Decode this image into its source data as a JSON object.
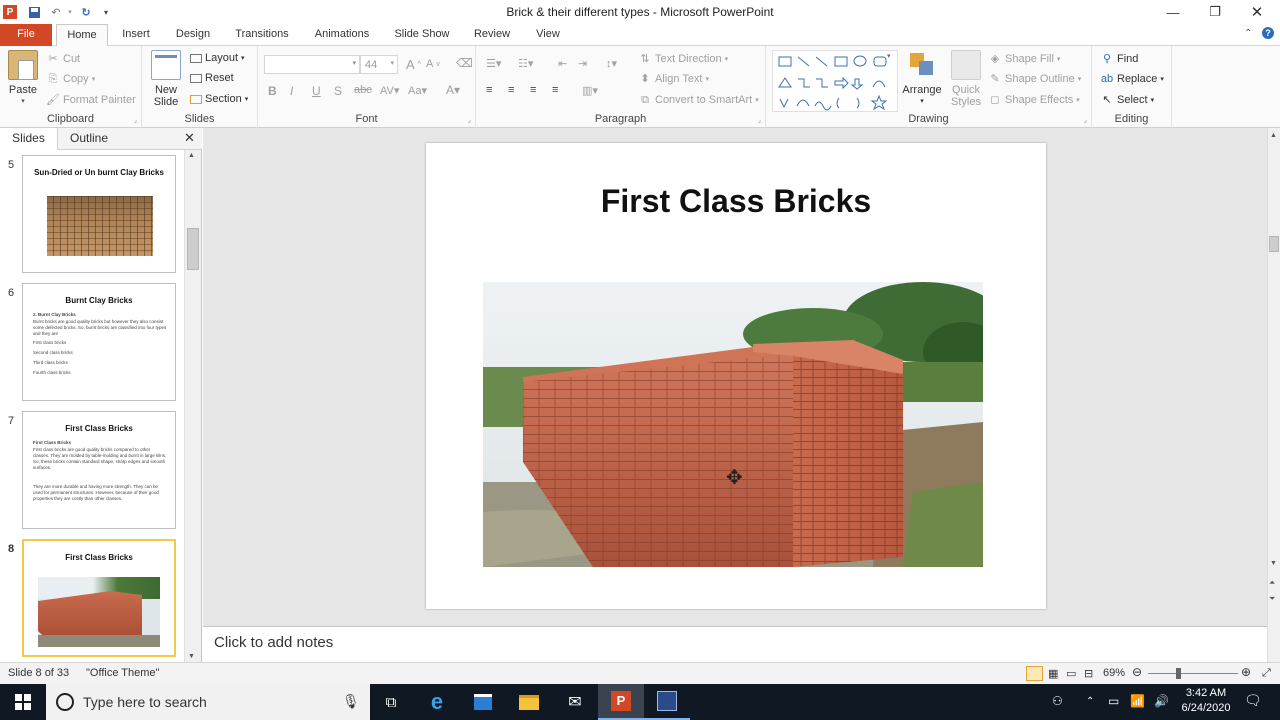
{
  "window": {
    "title": "Brick & their different types  -  Microsoft PowerPoint"
  },
  "tabs": [
    "File",
    "Home",
    "Insert",
    "Design",
    "Transitions",
    "Animations",
    "Slide Show",
    "Review",
    "View"
  ],
  "ribbon": {
    "clipboard": {
      "paste": "Paste",
      "cut": "Cut",
      "copy": "Copy",
      "format_painter": "Format Painter",
      "label": "Clipboard"
    },
    "slides": {
      "new_slide": "New Slide",
      "layout": "Layout",
      "reset": "Reset",
      "section": "Section",
      "label": "Slides"
    },
    "font": {
      "size": "44",
      "label": "Font"
    },
    "paragraph": {
      "text_direction": "Text Direction",
      "align_text": "Align Text",
      "convert": "Convert to SmartArt",
      "label": "Paragraph"
    },
    "drawing": {
      "arrange": "Arrange",
      "quick_styles": "Quick Styles",
      "shape_fill": "Shape Fill",
      "shape_outline": "Shape Outline",
      "shape_effects": "Shape Effects",
      "label": "Drawing"
    },
    "editing": {
      "find": "Find",
      "replace": "Replace",
      "select": "Select",
      "label": "Editing"
    }
  },
  "panel": {
    "tab_slides": "Slides",
    "tab_outline": "Outline"
  },
  "thumbnails": [
    {
      "num": "5",
      "title": "Sun-Dried or Un burnt Clay Bricks",
      "body": []
    },
    {
      "num": "6",
      "title": "Burnt Clay Bricks",
      "body": [
        "2. Burnt Clay Bricks",
        "Burnt bricks are good quality bricks but however they also consist some defected bricks. So, burnt bricks are classified into four types and they are",
        "First class bricks",
        "Second class bricks",
        "Third class bricks",
        "Fourth class bricks"
      ]
    },
    {
      "num": "7",
      "title": "First Class Bricks",
      "body": [
        "First Class Bricks",
        "First class bricks are good quality bricks compared to other classes. They are molded by table-molding and burnt in large kilns. So, these bricks contain standard shape, sharp edges and smooth surfaces.",
        "They are more durable and having more strength. They can be used for permanent structures. However, because of their good properties they are costly than other classes."
      ]
    },
    {
      "num": "8",
      "title": "First Class Bricks",
      "body": []
    }
  ],
  "slide": {
    "title": "First Class Bricks"
  },
  "notes": {
    "placeholder": "Click to add notes"
  },
  "status": {
    "slide_info": "Slide 8 of 33",
    "theme": "\"Office Theme\"",
    "zoom": "69%"
  },
  "taskbar": {
    "search_placeholder": "Type here to search",
    "time": "3:42 AM",
    "date": "6/24/2020"
  }
}
